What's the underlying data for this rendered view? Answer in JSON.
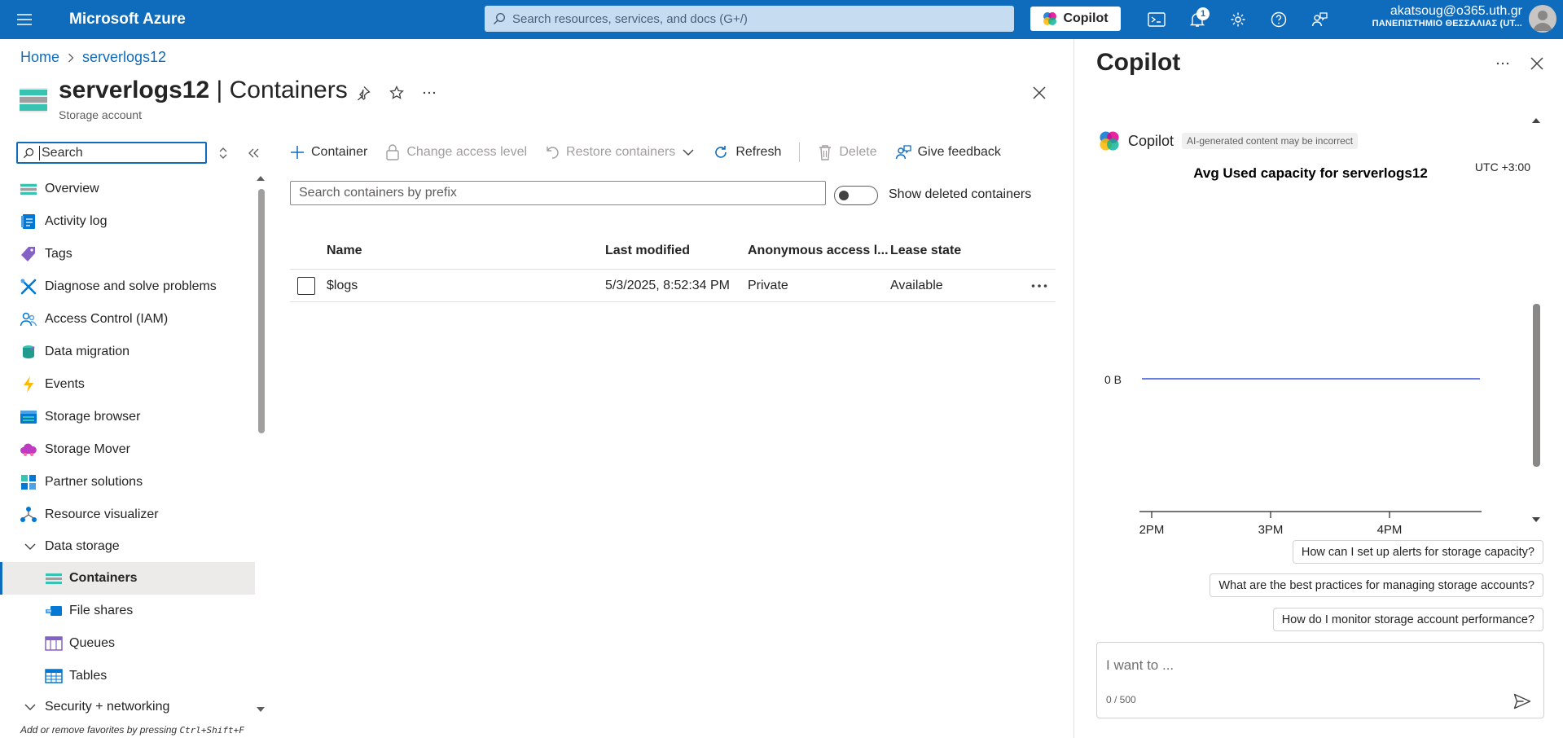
{
  "topbar": {
    "brand": "Microsoft Azure",
    "search_placeholder": "Search resources, services, and docs (G+/)",
    "copilot_label": "Copilot",
    "notification_count": "1",
    "account_email": "akatsoug@o365.uth.gr",
    "account_tenant": "ΠΑΝΕΠΙΣΤΗΜΙΟ ΘΕΣΣΑΛΙΑΣ (UT..."
  },
  "breadcrumb": [
    "Home",
    "serverlogs12"
  ],
  "page": {
    "title_resource": "serverlogs12",
    "title_section": "| Containers",
    "subtitle": "Storage account"
  },
  "nav": {
    "search_placeholder": "Search",
    "items": [
      {
        "label": "Overview",
        "icon": "overview-icon"
      },
      {
        "label": "Activity log",
        "icon": "activity-log-icon"
      },
      {
        "label": "Tags",
        "icon": "tag-icon"
      },
      {
        "label": "Diagnose and solve problems",
        "icon": "wrench-icon"
      },
      {
        "label": "Access Control (IAM)",
        "icon": "people-icon"
      },
      {
        "label": "Data migration",
        "icon": "data-migration-icon"
      },
      {
        "label": "Events",
        "icon": "lightning-icon"
      },
      {
        "label": "Storage browser",
        "icon": "storage-browser-icon"
      },
      {
        "label": "Storage Mover",
        "icon": "cloud-icon"
      },
      {
        "label": "Partner solutions",
        "icon": "partner-icon"
      },
      {
        "label": "Resource visualizer",
        "icon": "visualizer-icon"
      }
    ],
    "group_data_storage": "Data storage",
    "sub_items": [
      {
        "label": "Containers",
        "icon": "containers-icon"
      },
      {
        "label": "File shares",
        "icon": "file-shares-icon"
      },
      {
        "label": "Queues",
        "icon": "queues-icon"
      },
      {
        "label": "Tables",
        "icon": "tables-icon"
      }
    ],
    "group_security": "Security + networking",
    "footer_text": "Add or remove favorites by pressing",
    "footer_shortcut": "Ctrl+Shift+F"
  },
  "commands": {
    "container": "Container",
    "change_access": "Change access level",
    "restore": "Restore containers",
    "refresh": "Refresh",
    "delete": "Delete",
    "feedback": "Give feedback"
  },
  "filter": {
    "prefix_placeholder": "Search containers by prefix",
    "show_deleted": "Show deleted containers"
  },
  "table": {
    "headers": [
      "Name",
      "Last modified",
      "Anonymous access l...",
      "Lease state"
    ],
    "rows": [
      {
        "name": "$logs",
        "modified": "5/3/2025, 8:52:34 PM",
        "access": "Private",
        "lease": "Available"
      }
    ]
  },
  "copilot": {
    "title": "Copilot",
    "sender": "Copilot",
    "disclaimer": "AI-generated content may be incorrect",
    "suggestions": [
      "How can I set up alerts for storage capacity?",
      "What are the best practices for managing storage accounts?",
      "How do I monitor storage account performance?"
    ],
    "input_placeholder": "I want to ...",
    "char_count": "0 / 500"
  },
  "chart_data": {
    "type": "line",
    "title": "Avg Used capacity for serverlogs12",
    "timezone": "UTC +3:00",
    "x_ticks": [
      "2PM",
      "3PM",
      "4PM"
    ],
    "y_ticks": [
      "0 B"
    ],
    "series": [
      {
        "values": [
          0,
          0,
          0,
          0
        ],
        "x": [
          "2PM",
          "3PM",
          "4PM",
          "4:55PM"
        ],
        "color": "#6b7ee6"
      }
    ]
  },
  "colors": {
    "azure_blue": "#0f6cbd",
    "series_line": "#6b7ee6"
  }
}
